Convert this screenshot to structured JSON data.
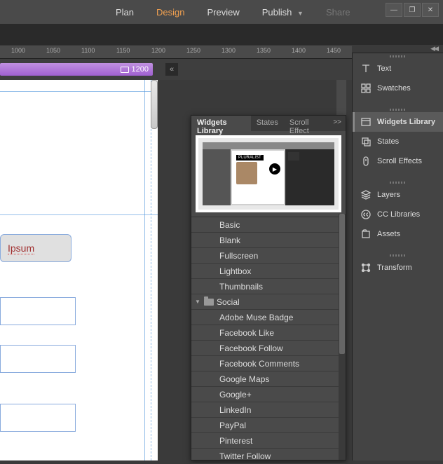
{
  "menubar": {
    "items": [
      {
        "label": "Plan",
        "active": false,
        "disabled": false
      },
      {
        "label": "Design",
        "active": true,
        "disabled": false
      },
      {
        "label": "Preview",
        "active": false,
        "disabled": false
      },
      {
        "label": "Publish",
        "active": false,
        "disabled": false,
        "dropdown": true
      },
      {
        "label": "Share",
        "active": false,
        "disabled": true
      }
    ]
  },
  "ruler": {
    "marks": [
      "1000",
      "1050",
      "1100",
      "1150",
      "1200",
      "1250",
      "1300",
      "1350",
      "1400",
      "1450"
    ]
  },
  "breakpoint": {
    "label": "1200"
  },
  "canvas": {
    "selected_text": "Ipsum"
  },
  "widgets_popup": {
    "tabs": [
      {
        "label": "Widgets Library",
        "active": true
      },
      {
        "label": "States",
        "active": false
      },
      {
        "label": "Scroll Effect",
        "active": false
      }
    ],
    "preview_logo": "PLURALIST",
    "list": [
      {
        "label": "Basic",
        "kind": "item"
      },
      {
        "label": "Blank",
        "kind": "item"
      },
      {
        "label": "Fullscreen",
        "kind": "item"
      },
      {
        "label": "Lightbox",
        "kind": "item"
      },
      {
        "label": "Thumbnails",
        "kind": "item"
      },
      {
        "label": "Social",
        "kind": "category"
      },
      {
        "label": "Adobe Muse Badge",
        "kind": "item"
      },
      {
        "label": "Facebook Like",
        "kind": "item"
      },
      {
        "label": "Facebook Follow",
        "kind": "item"
      },
      {
        "label": "Facebook Comments",
        "kind": "item"
      },
      {
        "label": "Google Maps",
        "kind": "item"
      },
      {
        "label": "Google+",
        "kind": "item"
      },
      {
        "label": "LinkedIn",
        "kind": "item"
      },
      {
        "label": "PayPal",
        "kind": "item"
      },
      {
        "label": "Pinterest",
        "kind": "item"
      },
      {
        "label": "Twitter Follow",
        "kind": "item"
      }
    ]
  },
  "dock": {
    "groups": [
      [
        {
          "label": "Text",
          "icon": "text",
          "active": false
        },
        {
          "label": "Swatches",
          "icon": "swatches",
          "active": false
        }
      ],
      [
        {
          "label": "Widgets Library",
          "icon": "widgets",
          "active": true
        },
        {
          "label": "States",
          "icon": "states",
          "active": false
        },
        {
          "label": "Scroll Effects",
          "icon": "scroll",
          "active": false
        }
      ],
      [
        {
          "label": "Layers",
          "icon": "layers",
          "active": false
        },
        {
          "label": "CC Libraries",
          "icon": "cc",
          "active": false
        },
        {
          "label": "Assets",
          "icon": "assets",
          "active": false
        }
      ],
      [
        {
          "label": "Transform",
          "icon": "transform",
          "active": false
        }
      ]
    ]
  }
}
